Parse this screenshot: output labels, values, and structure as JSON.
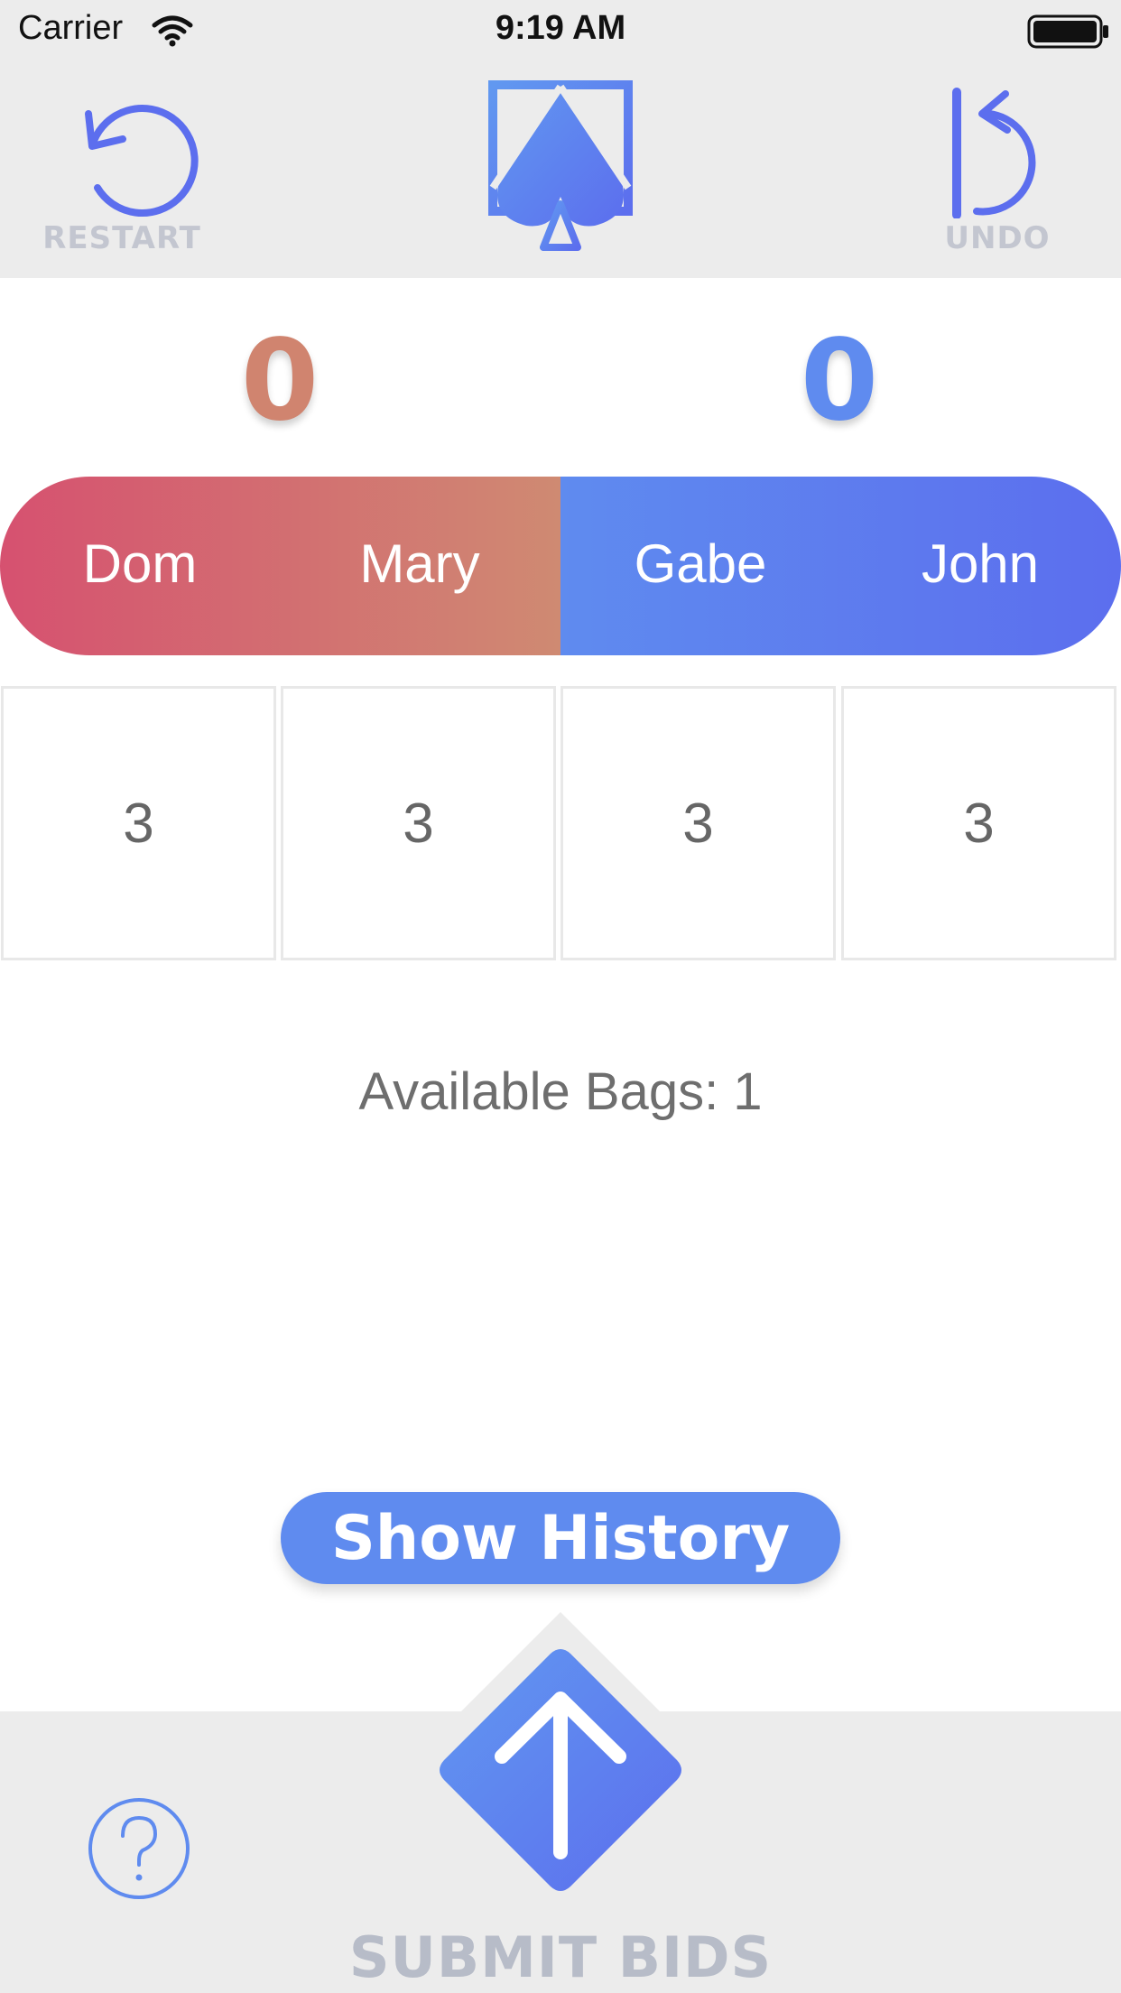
{
  "status_bar": {
    "carrier": "Carrier",
    "time": "9:19 AM"
  },
  "header": {
    "restart_label": "RESTART",
    "undo_label": "UNDO",
    "logo_icon": "spade-logo-icon"
  },
  "colors": {
    "team1": "#d0846f",
    "team2": "#5f8bef",
    "accent": "#5c6eee",
    "muted": "#c3c6d0"
  },
  "scores": {
    "team1": "0",
    "team2": "0"
  },
  "players": [
    {
      "name": "Dom",
      "bid": "3"
    },
    {
      "name": "Mary",
      "bid": "3"
    },
    {
      "name": "Gabe",
      "bid": "3"
    },
    {
      "name": "John",
      "bid": "3"
    }
  ],
  "bags_text": "Available Bags: 1",
  "history_button": "Show History",
  "submit_label": "SUBMIT BIDS",
  "help_icon": "question-mark-icon"
}
